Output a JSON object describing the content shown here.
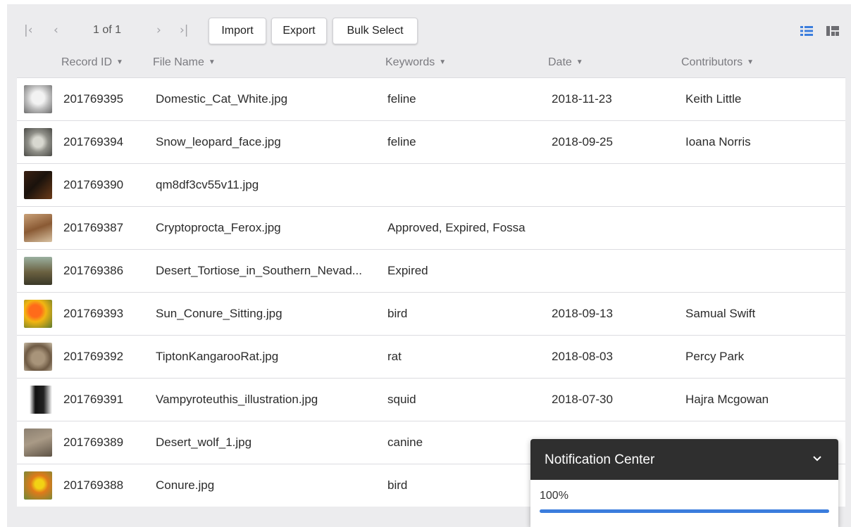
{
  "toolbar": {
    "first_page_icon": "first-page-icon",
    "prev_page_icon": "previous-page-icon",
    "page_indicator": "1 of 1",
    "next_page_icon": "next-page-icon",
    "last_page_icon": "last-page-icon",
    "import_label": "Import",
    "export_label": "Export",
    "bulk_select_label": "Bulk Select",
    "list_view_icon": "list-view-icon",
    "grid_view_icon": "grid-view-icon"
  },
  "columns": [
    {
      "label": "Record ID"
    },
    {
      "label": "File Name"
    },
    {
      "label": "Keywords"
    },
    {
      "label": "Date"
    },
    {
      "label": "Contributors"
    }
  ],
  "rows": [
    {
      "thumb": "cat-thumbnail",
      "id": "201769395",
      "file": "Domestic_Cat_White.jpg",
      "keywords": "feline",
      "date": "2018-11-23",
      "contributor": "Keith Little"
    },
    {
      "thumb": "snow-leopard-thumbnail",
      "id": "201769394",
      "file": "Snow_leopard_face.jpg",
      "keywords": "feline",
      "date": "2018-09-25",
      "contributor": "Ioana Norris"
    },
    {
      "thumb": "dark-photo-thumbnail",
      "id": "201769390",
      "file": "qm8df3cv55v11.jpg",
      "keywords": "",
      "date": "",
      "contributor": ""
    },
    {
      "thumb": "fossa-thumbnail",
      "id": "201769387",
      "file": "Cryptoprocta_Ferox.jpg",
      "keywords": "Approved, Expired, Fossa",
      "date": "",
      "contributor": ""
    },
    {
      "thumb": "tortoise-thumbnail",
      "id": "201769386",
      "file": "Desert_Tortiose_in_Southern_Nevad...",
      "keywords": "Expired",
      "date": "",
      "contributor": ""
    },
    {
      "thumb": "sun-conure-thumbnail",
      "id": "201769393",
      "file": "Sun_Conure_Sitting.jpg",
      "keywords": "bird",
      "date": "2018-09-13",
      "contributor": "Samual Swift"
    },
    {
      "thumb": "kangaroo-rat-thumbnail",
      "id": "201769392",
      "file": "TiptonKangarooRat.jpg",
      "keywords": "rat",
      "date": "2018-08-03",
      "contributor": "Percy Park"
    },
    {
      "thumb": "squid-illustration-thumbnail",
      "id": "201769391",
      "file": "Vampyroteuthis_illustration.jpg",
      "keywords": "squid",
      "date": "2018-07-30",
      "contributor": "Hajra Mcgowan"
    },
    {
      "thumb": "wolf-thumbnail",
      "id": "201769389",
      "file": "Desert_wolf_1.jpg",
      "keywords": "canine",
      "date": "",
      "contributor": ""
    },
    {
      "thumb": "conure-thumbnail",
      "id": "201769388",
      "file": "Conure.jpg",
      "keywords": "bird",
      "date": "",
      "contributor": ""
    }
  ],
  "notification": {
    "title": "Notification Center",
    "chevron_icon": "chevron-down-icon",
    "progress_text": "100%",
    "progress_fraction": 1.0,
    "bar_color": "#3b7ddd"
  },
  "colors": {
    "accent": "#3b7ddd",
    "header_bg": "#2f2f2f",
    "panel_bg": "#ececee"
  }
}
